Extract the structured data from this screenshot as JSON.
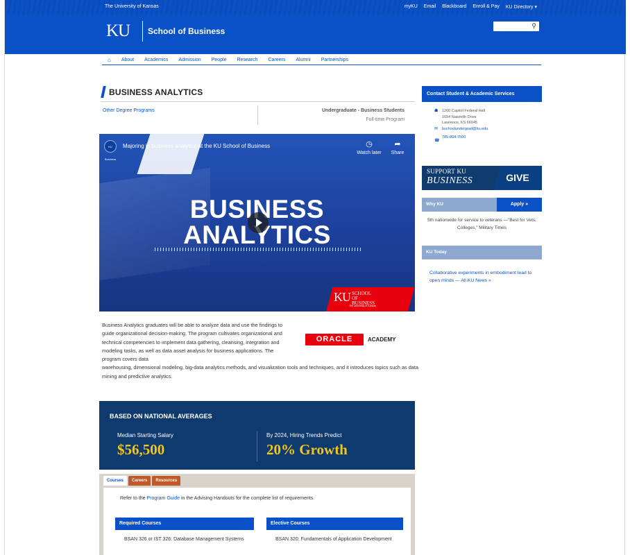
{
  "header": {
    "university": "The University of Kansas",
    "utility_links": [
      "myKU",
      "Email",
      "Blackboard",
      "Enroll & Pay",
      "KU Directory ▾"
    ],
    "logo": "KU",
    "school": "School of Business",
    "search_placeholder": ""
  },
  "nav": {
    "items": [
      "About",
      "Academics",
      "Admission",
      "People",
      "Research",
      "Careers",
      "Alumni",
      "Partnerships"
    ]
  },
  "main": {
    "title": "BUSINESS ANALYTICS",
    "other_programs": "Other Degree Programs",
    "degree_level": "Undergraduate - Business Students",
    "degree_type": "Full-time Program",
    "video": {
      "channel": "KU Business",
      "title": "Majoring in business analytics at the KU School of Business",
      "watch_later": "Watch later",
      "share": "Share",
      "headline_1": "BUSINESS",
      "headline_2": "ANALYTICS",
      "badge_logo": "KU",
      "badge_school": "SCHOOL OF BUSINESS",
      "badge_uni": "The University of Kansas"
    },
    "description_1": "Business Analytics graduates will be able to analyze data and use the findings to guide organizational decision-making. The program cultivates organizational and technical competencies to implement data gathering, cleansing, integration and modeling tasks, as well as data asset analysis for business applications. The program covers data",
    "description_2": "warehousing, dimensional modeling, big-data analytics methods, and visualization tools and techniques, and it introduces topics such as data mining and predictive analytics.",
    "oracle": "ORACLE",
    "academy": "ACADEMY",
    "stats": {
      "heading": "BASED ON NATIONAL AVERAGES",
      "left_label": "Median Starting Salary",
      "left_value": "$56,500",
      "right_label": "By 2024, Hiring Trends Predict",
      "right_value": "20% Growth"
    },
    "tabs": [
      "Courses",
      "Careers",
      "Resources"
    ],
    "refer_prefix": "Refer to the ",
    "refer_link": "Program Guide",
    "refer_suffix": " in the Advising Handouts for the complete list of requirements.",
    "required_heading": "Required Courses",
    "required_first": "BSAN 326 or IST 326: Database Management Systems",
    "elective_heading": "Elective Courses",
    "elective_first": "BSAN 320: Fundamentals of Application Development"
  },
  "sidebar": {
    "contact_heading": "Contact Student & Academic Services",
    "address_1": "1260 Capitol Federal Hall",
    "address_2": "1654 Naismith Drive",
    "address_3": "Lawrence, KS 66045",
    "email": "bschoolundergrad@ku.edu",
    "phone": "785-864-7500",
    "support_1": "SUPPORT KU",
    "support_2": "BUSINESS",
    "give": "GIVE",
    "why_ku": "Why KU",
    "apply": "Apply »",
    "fact": "5th nationwide for service to veterans —\"Best for Vets: Colleges,\" Military Times",
    "ku_today": "KU Today",
    "news": "Collaborative experiments in embodiment lead to open minds — All KU News »"
  }
}
